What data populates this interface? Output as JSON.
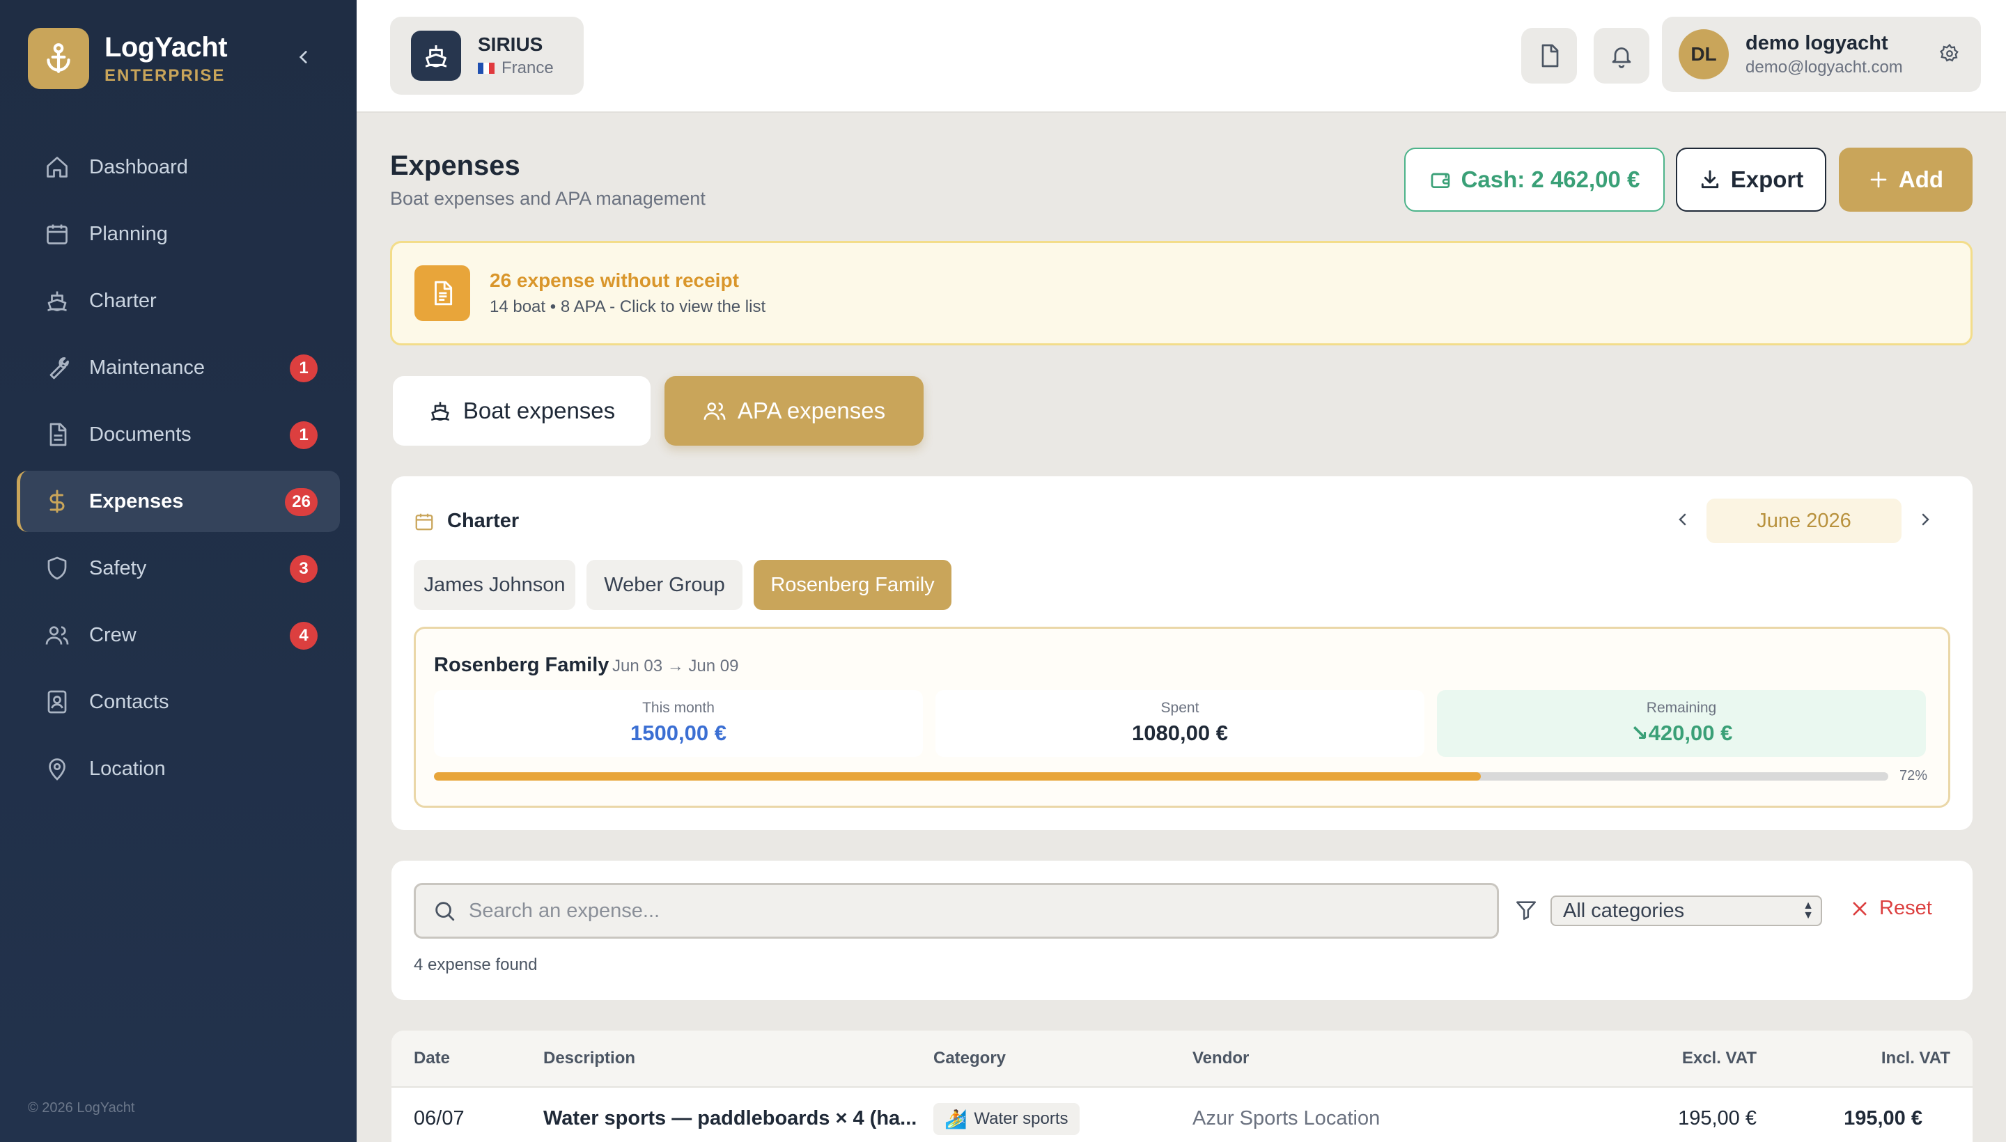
{
  "brand": {
    "name": "LogYacht",
    "edition": "ENTERPRISE"
  },
  "sidebar": {
    "items": [
      {
        "label": "Dashboard",
        "icon": "home-icon",
        "badge": ""
      },
      {
        "label": "Planning",
        "icon": "calendar-icon",
        "badge": ""
      },
      {
        "label": "Charter",
        "icon": "ship-icon",
        "badge": ""
      },
      {
        "label": "Maintenance",
        "icon": "wrench-icon",
        "badge": "1"
      },
      {
        "label": "Documents",
        "icon": "document-icon",
        "badge": "1"
      },
      {
        "label": "Expenses",
        "icon": "dollar-icon",
        "badge": "26"
      },
      {
        "label": "Safety",
        "icon": "shield-icon",
        "badge": "3"
      },
      {
        "label": "Crew",
        "icon": "users-icon",
        "badge": "4"
      },
      {
        "label": "Contacts",
        "icon": "contact-icon",
        "badge": ""
      },
      {
        "label": "Location",
        "icon": "map-pin-icon",
        "badge": ""
      }
    ],
    "active_index": 5,
    "copyright": "© 2026 LogYacht"
  },
  "header": {
    "boat": {
      "name": "SIRIUS",
      "country": "France"
    },
    "user": {
      "initials": "DL",
      "name": "demo logyacht",
      "email": "demo@logyacht.com"
    }
  },
  "page": {
    "title": "Expenses",
    "subtitle": "Boat expenses and APA management",
    "cash_label": "Cash: 2 462,00 €",
    "export_label": "Export",
    "add_label": "Add"
  },
  "alert": {
    "title": "26 expense without receipt",
    "subtitle": "14 boat • 8 APA - Click to view the list"
  },
  "tabs": {
    "boat": "Boat expenses",
    "apa": "APA expenses",
    "active": "apa"
  },
  "charter": {
    "label": "Charter",
    "month": "June 2026",
    "chips": [
      "James Johnson",
      "Weber Group",
      "Rosenberg Family"
    ],
    "active_chip": 2,
    "detail": {
      "name": "Rosenberg Family",
      "dates": "Jun 03 → Jun 09",
      "this_month_label": "This month",
      "this_month_value": "1500,00 €",
      "spent_label": "Spent",
      "spent_value": "1080,00 €",
      "remaining_label": "Remaining",
      "remaining_value": "↘420,00 €",
      "progress_percent": 72,
      "progress_label": "72%"
    }
  },
  "search": {
    "placeholder": "Search an expense...",
    "category_selected": "All categories",
    "reset_label": "Reset",
    "found": "4 expense found"
  },
  "table": {
    "headers": {
      "date": "Date",
      "description": "Description",
      "category": "Category",
      "vendor": "Vendor",
      "excl": "Excl. VAT",
      "incl": "Incl. VAT"
    },
    "rows": [
      {
        "date": "06/07",
        "description": "Water sports — paddleboards × 4 (ha...",
        "category": "Water sports",
        "vendor": "Azur Sports Location",
        "excl": "195,00 €",
        "incl": "195,00 €"
      }
    ]
  },
  "colors": {
    "accent": "#c9a55a",
    "sidebar": "#1f2d44",
    "danger": "#dc3f3f",
    "success": "#3aa077",
    "warning": "#e8a53a"
  }
}
